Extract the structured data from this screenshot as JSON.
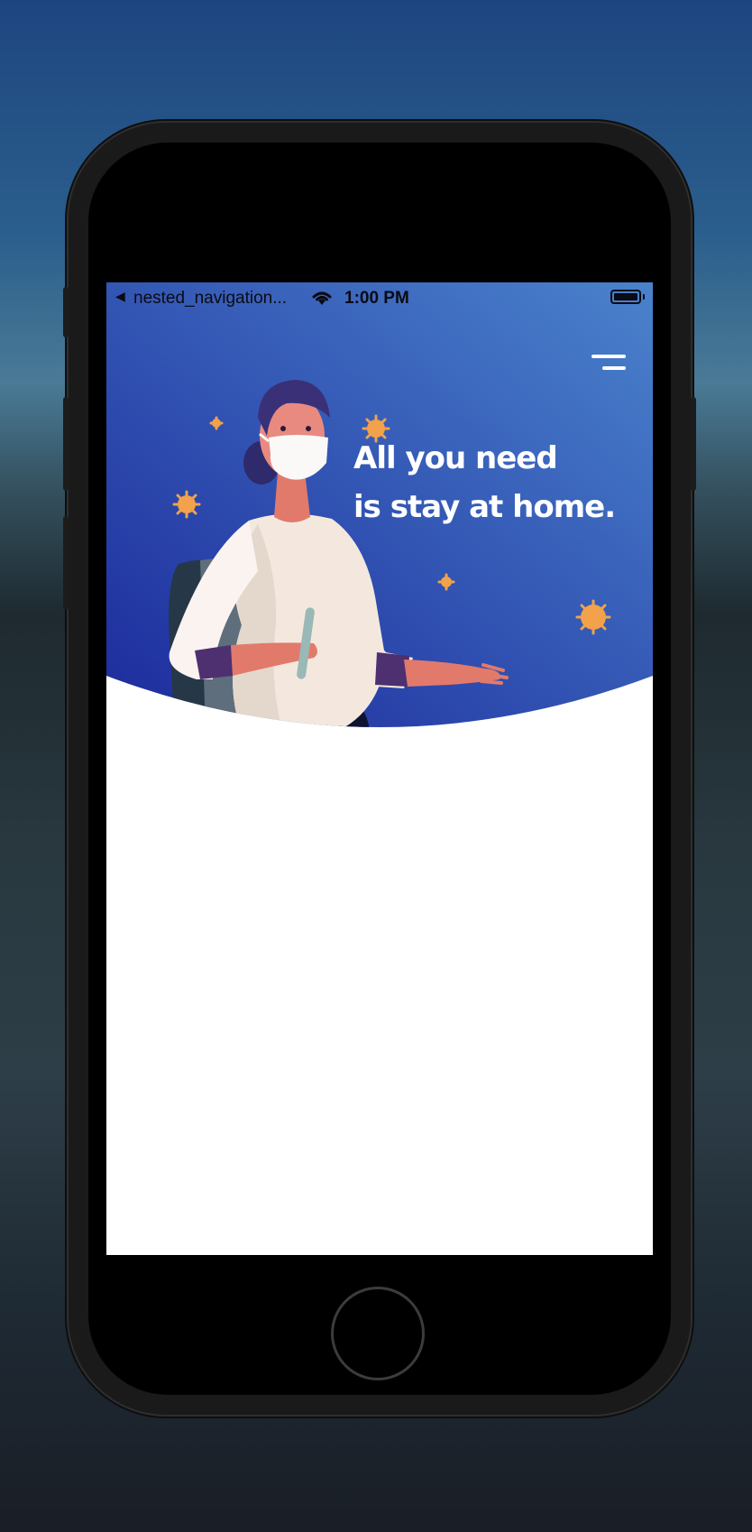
{
  "status_bar": {
    "back_glyph": "◀",
    "app_name": "nested_navigation...",
    "wifi_icon": "wifi-icon",
    "time": "1:00 PM",
    "battery_icon": "battery-icon"
  },
  "header": {
    "menu_icon": "menu-icon",
    "headline_line1": "All you need",
    "headline_line2": "is stay at home."
  },
  "colors": {
    "hero_gradient_start": "#1c2a9c",
    "hero_gradient_end": "#4a82cc",
    "text_on_hero": "#ffffff",
    "virus": "#f2a24a",
    "background": "#ffffff"
  }
}
